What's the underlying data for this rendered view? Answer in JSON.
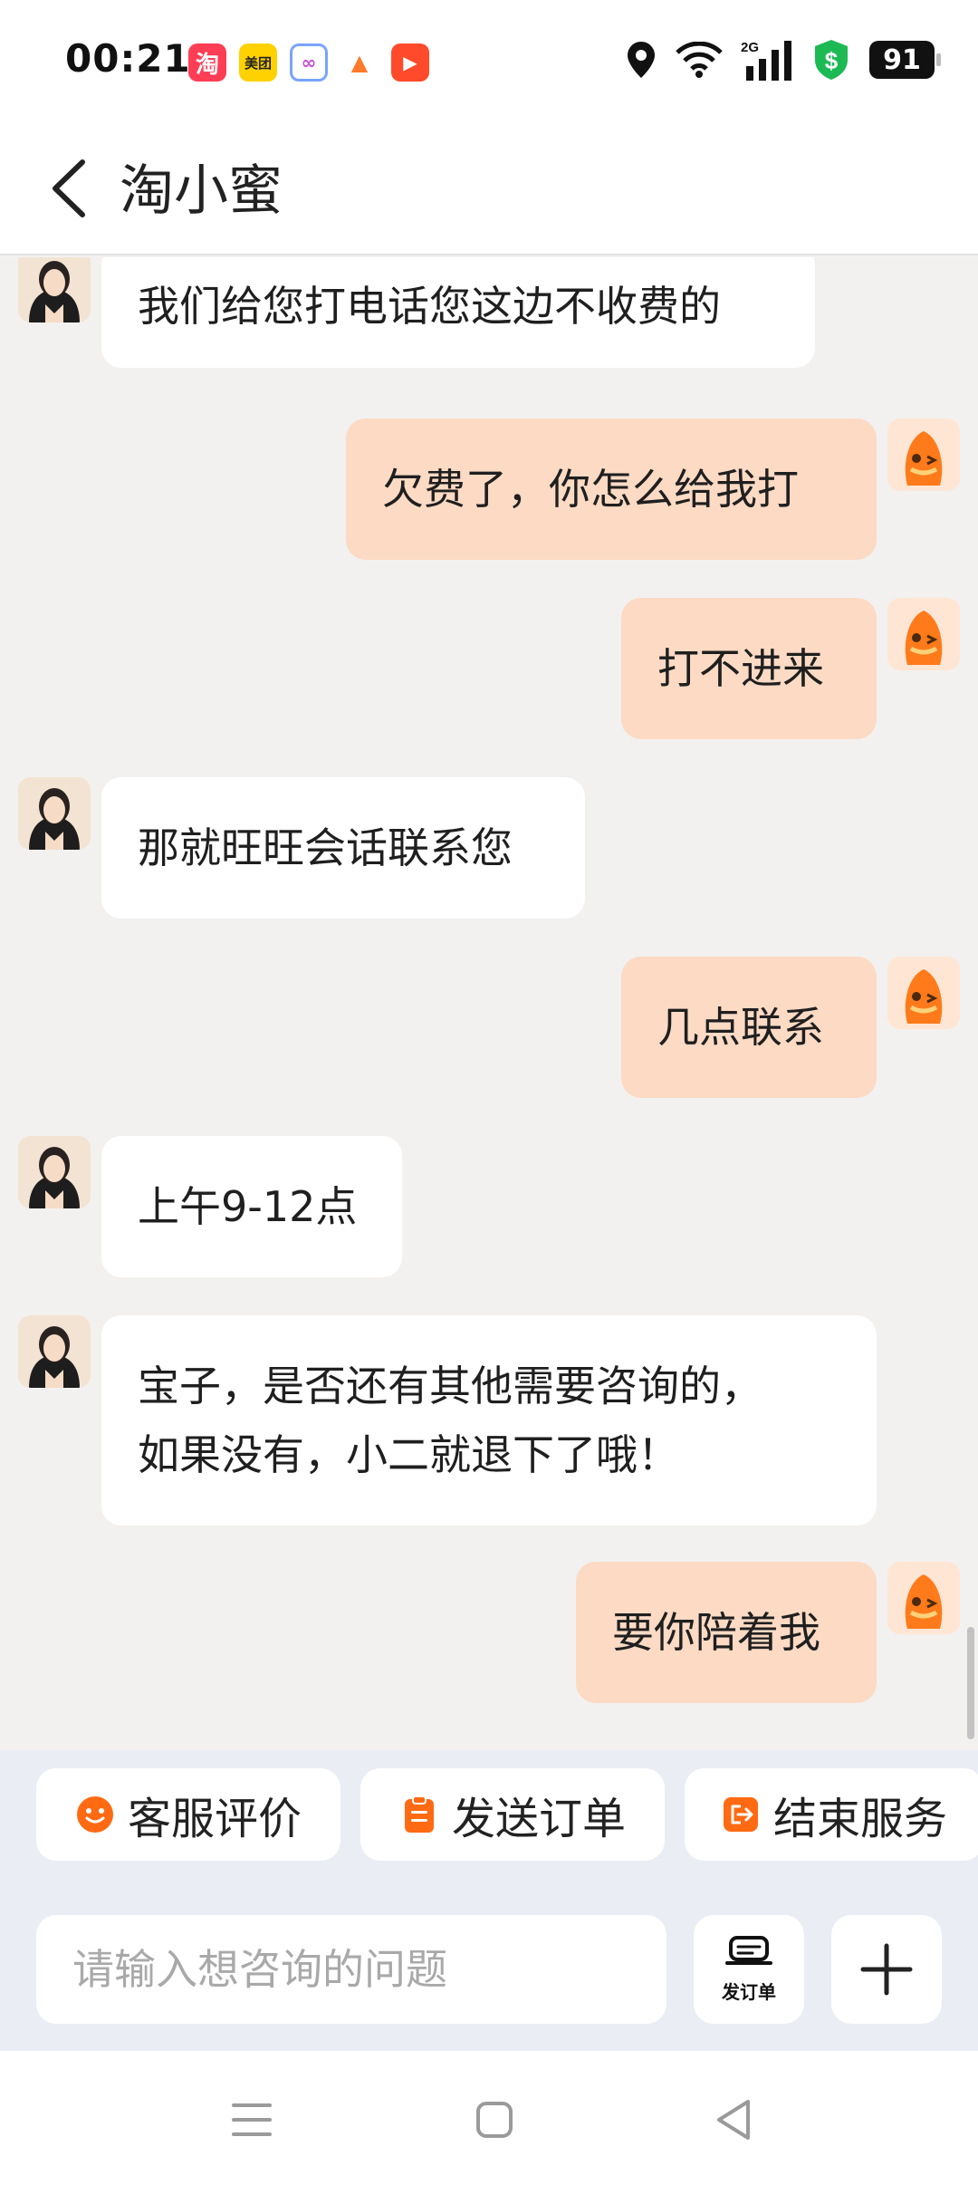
{
  "status_bar": {
    "time": "00:21",
    "notification_icons": [
      "taobao-icon",
      "meituan-icon",
      "link-app-icon",
      "game-icon",
      "video-icon"
    ],
    "notification_labels": {
      "taobao": "淘",
      "meituan": "美团"
    },
    "network": "2G",
    "battery": "91"
  },
  "header": {
    "title": "淘小蜜"
  },
  "messages": [
    {
      "from": "agent",
      "text": "我们给您打电话您这边不收费的"
    },
    {
      "from": "user",
      "text": "欠费了，你怎么给我打"
    },
    {
      "from": "user",
      "text": "打不进来"
    },
    {
      "from": "agent",
      "text": "那就旺旺会话联系您"
    },
    {
      "from": "user",
      "text": "几点联系"
    },
    {
      "from": "agent",
      "text": "上午9-12点"
    },
    {
      "from": "agent",
      "lines": [
        "宝子，是否还有其他需要咨询的，",
        "如果没有，小二就退下了哦！"
      ]
    },
    {
      "from": "user",
      "text": "要你陪着我"
    }
  ],
  "quick_actions": [
    {
      "label": "客服评价",
      "icon": "smiley-icon"
    },
    {
      "label": "发送订单",
      "icon": "clipboard-icon"
    },
    {
      "label": "结束服务",
      "icon": "exit-icon"
    }
  ],
  "input": {
    "placeholder": "请输入想咨询的问题"
  },
  "order_button": {
    "label": "发订单"
  },
  "colors": {
    "accent": "#ff6a13",
    "user_bubble": "#fcdac4",
    "agent_bubble": "#ffffff",
    "chat_background": "#f2f1ef",
    "bottom_panel": "#eaedf4"
  }
}
